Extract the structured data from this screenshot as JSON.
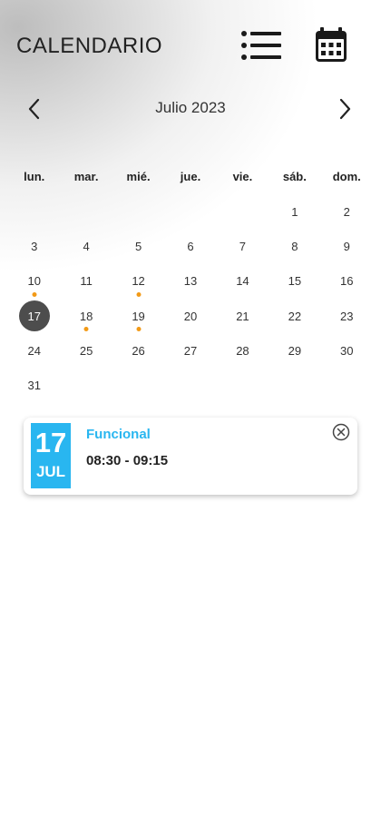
{
  "header": {
    "title": "CALENDARIO",
    "list_icon": "list-icon",
    "calendar_icon": "calendar-icon"
  },
  "month_nav": {
    "label": "Julio 2023",
    "prev_icon": "chevron-left-icon",
    "next_icon": "chevron-right-icon"
  },
  "weekdays": [
    "lun.",
    "mar.",
    "mié.",
    "jue.",
    "vie.",
    "sáb.",
    "dom."
  ],
  "calendar": {
    "leading_blank_days": 5,
    "days": [
      "1",
      "2",
      "3",
      "4",
      "5",
      "6",
      "7",
      "8",
      "9",
      "10",
      "11",
      "12",
      "13",
      "14",
      "15",
      "16",
      "17",
      "18",
      "19",
      "20",
      "21",
      "22",
      "23",
      "24",
      "25",
      "26",
      "27",
      "28",
      "29",
      "30",
      "31"
    ],
    "selected_day": "17",
    "event_days": [
      "10",
      "12",
      "18",
      "19"
    ]
  },
  "colors": {
    "accent": "#29b6f0",
    "event_dot": "#f29a17",
    "selected": "#4d4d4d"
  },
  "event": {
    "day": "17",
    "month": "JUL",
    "title": "Funcional",
    "time": "08:30 - 09:15",
    "close_icon": "close-circle-icon"
  }
}
